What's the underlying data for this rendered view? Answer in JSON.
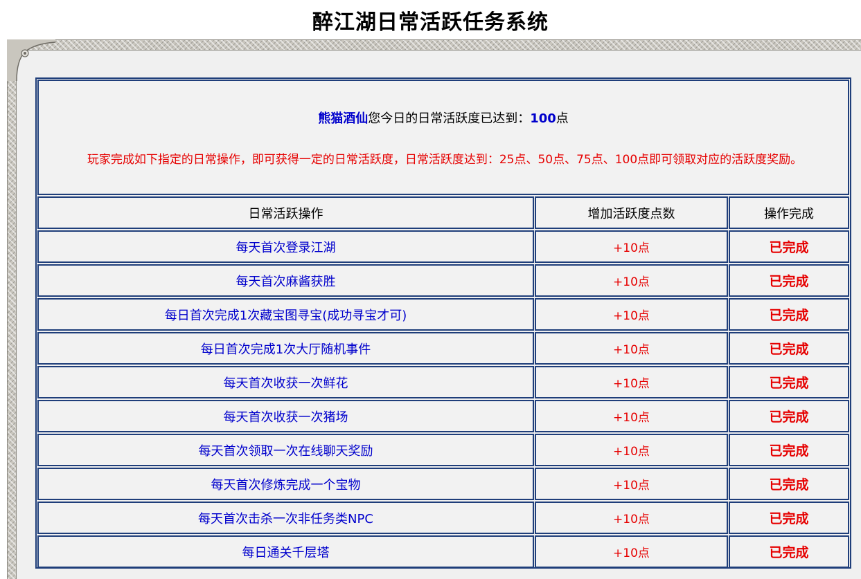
{
  "title": "醉江湖日常活跃任务系统",
  "info": {
    "player_name": "熊猫酒仙",
    "status_text": "您今日的日常活跃度已达到：",
    "points_value": "100",
    "points_unit": "点",
    "description": "玩家完成如下指定的日常操作，即可获得一定的日常活跃度，日常活跃度达到：25点、50点、75点、100点即可领取对应的活跃度奖励。"
  },
  "table": {
    "headers": [
      "日常活跃操作",
      "增加活跃度点数",
      "操作完成"
    ],
    "rows": [
      {
        "task": "每天首次登录江湖",
        "points": "+10点",
        "status": "已完成"
      },
      {
        "task": "每天首次麻酱获胜",
        "points": "+10点",
        "status": "已完成"
      },
      {
        "task": "每日首次完成1次藏宝图寻宝(成功寻宝才可)",
        "points": "+10点",
        "status": "已完成"
      },
      {
        "task": "每日首次完成1次大厅随机事件",
        "points": "+10点",
        "status": "已完成"
      },
      {
        "task": "每天首次收获一次鲜花",
        "points": "+10点",
        "status": "已完成"
      },
      {
        "task": "每天首次收获一次猪场",
        "points": "+10点",
        "status": "已完成"
      },
      {
        "task": "每天首次领取一次在线聊天奖励",
        "points": "+10点",
        "status": "已完成"
      },
      {
        "task": "每天首次修炼完成一个宝物",
        "points": "+10点",
        "status": "已完成"
      },
      {
        "task": "每天首次击杀一次非任务类NPC",
        "points": "+10点",
        "status": "已完成"
      },
      {
        "task": "每日通关千层塔",
        "points": "+10点",
        "status": "已完成"
      }
    ]
  },
  "colors": {
    "border": "#1f3e7a",
    "task_text": "#0000cc",
    "highlight_red": "#e60000",
    "cell_bg": "#f2f2f2"
  }
}
